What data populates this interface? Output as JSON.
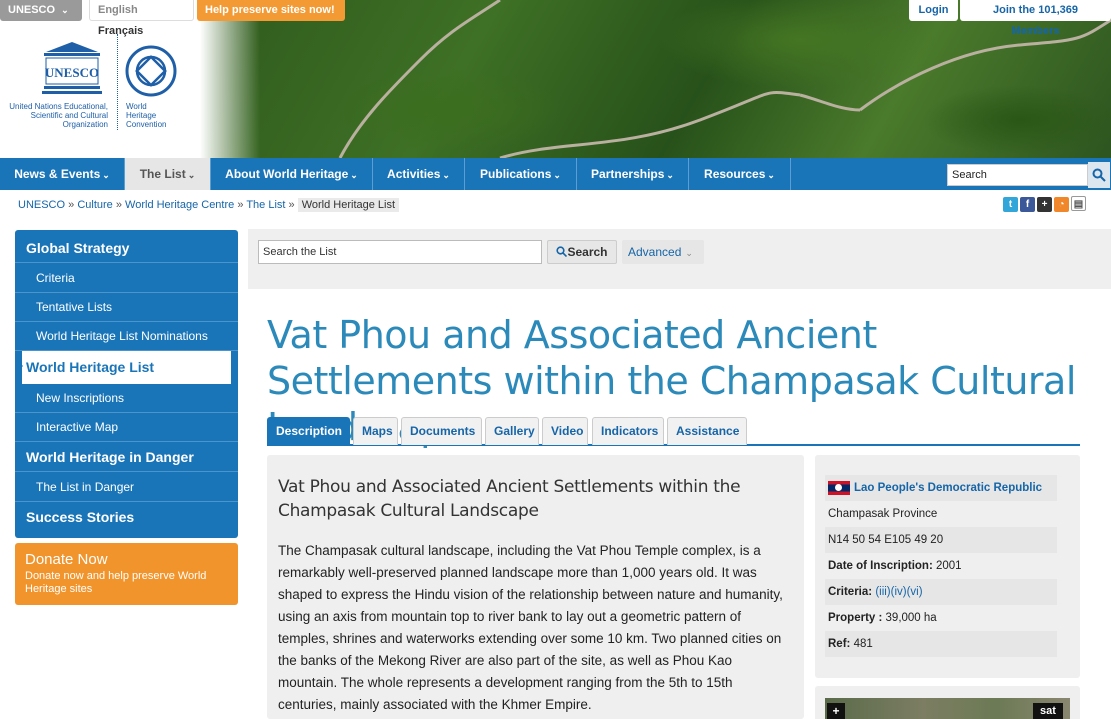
{
  "topbar": {
    "unesco_label": "UNESCO",
    "lang_english": "English",
    "lang_french": "Français",
    "help_label": "Help preserve sites now!",
    "login_label": "Login",
    "join_label": "Join the 101,369 Members"
  },
  "logo": {
    "unesco_org_text": "United Nations Educational, Scientific and Cultural Organization",
    "unesco_word": "UNESCO",
    "whc_text": "World Heritage Convention"
  },
  "nav": {
    "items": [
      {
        "label": "News & Events"
      },
      {
        "label": "The List"
      },
      {
        "label": "About World Heritage"
      },
      {
        "label": "Activities"
      },
      {
        "label": "Publications"
      },
      {
        "label": "Partnerships"
      },
      {
        "label": "Resources"
      }
    ],
    "search_value": "Search"
  },
  "breadcrumb": {
    "items": [
      "UNESCO",
      "Culture",
      "World Heritage Centre",
      "The List"
    ],
    "current": "World Heritage List",
    "separator": "»"
  },
  "sidebar": {
    "items": [
      {
        "label": "Global Strategy"
      },
      {
        "label": "Criteria"
      },
      {
        "label": "Tentative Lists"
      },
      {
        "label": "World Heritage List Nominations"
      },
      {
        "label": "World Heritage List"
      },
      {
        "label": "New Inscriptions"
      },
      {
        "label": "Interactive Map"
      },
      {
        "label": "World Heritage in Danger"
      },
      {
        "label": "The List in Danger"
      },
      {
        "label": "Success Stories"
      }
    ],
    "donate_title": "Donate Now",
    "donate_text": "Donate now and help preserve World Heritage sites"
  },
  "search_list": {
    "value": "Search the List",
    "button_label": "Search",
    "advanced_label": "Advanced"
  },
  "page_title": "Vat Phou and Associated Ancient Settlements within the Champasak Cultural Landscape",
  "tabs": [
    {
      "label": "Description"
    },
    {
      "label": "Maps"
    },
    {
      "label": "Documents"
    },
    {
      "label": "Gallery"
    },
    {
      "label": "Video"
    },
    {
      "label": "Indicators"
    },
    {
      "label": "Assistance"
    }
  ],
  "description": {
    "heading": "Vat Phou and Associated Ancient Settlements within the Champasak Cultural Landscape",
    "body": "The Champasak cultural landscape, including the Vat Phou Temple complex, is a remarkably well-preserved planned landscape more than 1,000 years old. It was shaped to express the Hindu vision of the relationship between nature and humanity, using an axis from mountain top to river bank to lay out a geometric pattern of temples, shrines and waterworks extending over some 10 km. Two planned cities on the banks of the Mekong River are also part of the site, as well as Phou Kao mountain. The whole represents a development ranging from the 5th to 15th centuries, mainly associated with the Khmer Empire."
  },
  "info": {
    "country": "Lao People's Democratic Republic",
    "province": "Champasak Province",
    "coordinates": "N14 50 54 E105 49 20",
    "inscription_label": "Date of Inscription:",
    "inscription_value": "2001",
    "criteria_label": "Criteria:",
    "criteria_value": "(iii)(iv)(vi)",
    "property_label": "Property :",
    "property_value": "39,000 ha",
    "ref_label": "Ref:",
    "ref_value": "481"
  },
  "map": {
    "plus_label": "+",
    "sat_label": "sat"
  },
  "colors": {
    "nav_blue": "#1a75b8",
    "title_blue": "#2b8ab9",
    "donate_orange": "#f2942c",
    "help_orange": "#f39a34"
  }
}
